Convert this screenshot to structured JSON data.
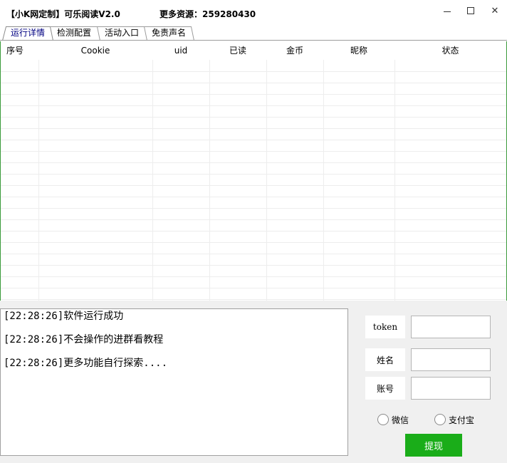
{
  "window": {
    "title": "【小K网定制】可乐阅读V2.0",
    "extra_info": "更多资源：259280430",
    "controls": {
      "minimize": "–",
      "maximize": "□",
      "close": "✕"
    }
  },
  "tabs": [
    {
      "label": "运行详情",
      "active": true
    },
    {
      "label": "检测配置",
      "active": false
    },
    {
      "label": "活动入口",
      "active": false
    },
    {
      "label": "免责声名",
      "active": false
    }
  ],
  "table": {
    "columns": [
      "序号",
      "Cookie",
      "uid",
      "已读",
      "金币",
      "昵称",
      "状态"
    ],
    "rows": []
  },
  "log": {
    "lines": [
      "[22:28:26]软件运行成功",
      "[22:28:26]不会操作的进群看教程",
      "[22:28:26]更多功能自行探索...."
    ]
  },
  "form": {
    "token_label": "token",
    "token_value": "",
    "name_label": "姓名",
    "name_value": "",
    "account_label": "账号",
    "account_value": "",
    "radio_wechat": "微信",
    "radio_alipay": "支付宝",
    "submit_label": "提现"
  },
  "colors": {
    "submit_bg": "#1aad19",
    "active_tab_text": "#000080",
    "grid_side_border": "#3a9a3a"
  }
}
